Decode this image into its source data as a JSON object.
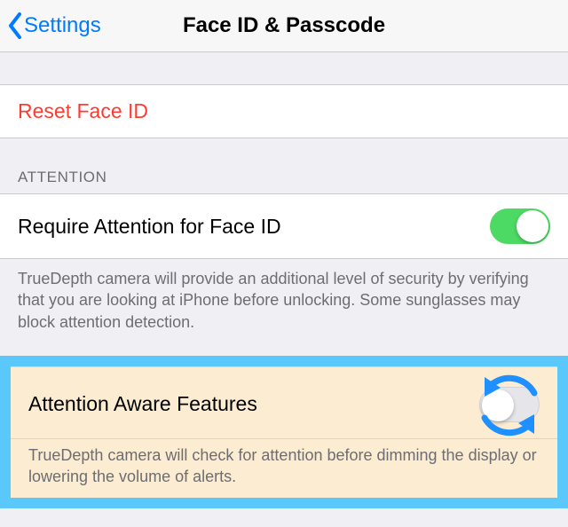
{
  "nav": {
    "back_label": "Settings",
    "title": "Face ID & Passcode"
  },
  "reset": {
    "label": "Reset Face ID"
  },
  "attention": {
    "header": "ATTENTION",
    "require_label": "Require Attention for Face ID",
    "require_on": true,
    "require_footer": "TrueDepth camera will provide an additional level of security by verifying that you are looking at iPhone before unlocking. Some sunglasses may block attention detection.",
    "aware_label": "Attention  Aware Features",
    "aware_on": false,
    "aware_footer": "TrueDepth camera will check for attention before dimming the display or lowering the volume of alerts."
  },
  "colors": {
    "ios_blue": "#007aff",
    "ios_green": "#4cd964",
    "ios_red": "#ff3b30",
    "highlight_border": "#5ac8fa",
    "highlight_bg": "#fbecd2"
  }
}
